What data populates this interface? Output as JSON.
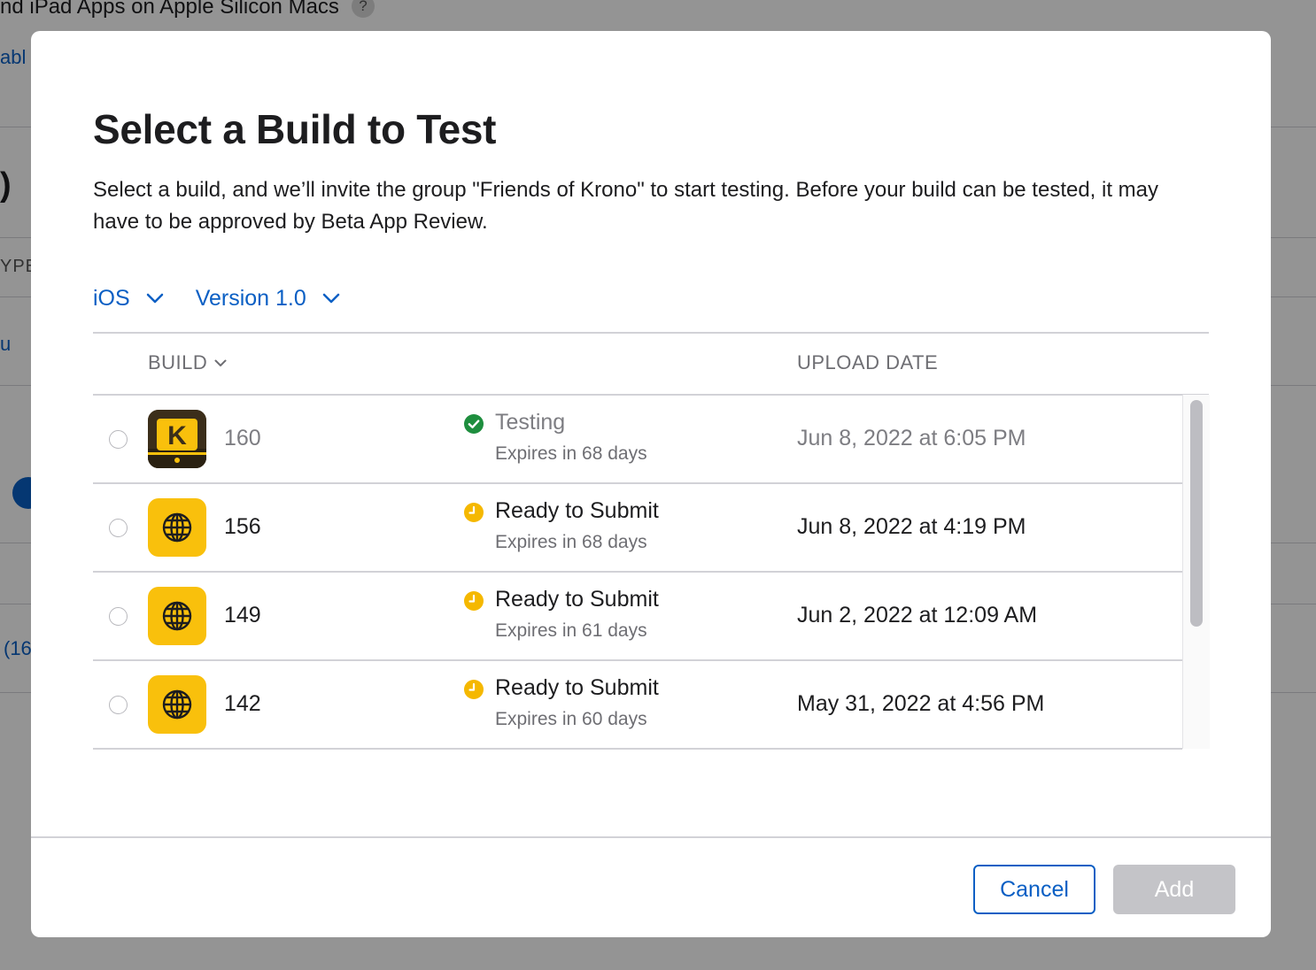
{
  "background": {
    "heading": "nd iPad Apps on Apple Silicon Macs",
    "help_glyph": "?",
    "link1": "abl",
    "paren": ")",
    "column": "YPE",
    "link2": "u",
    "link3": "(16"
  },
  "modal": {
    "title": "Select a Build to Test",
    "description": "Select a build, and we’ll invite the group \"Friends of Krono\" to start testing. Before your build can be tested, it may have to be approved by Beta App Review.",
    "filters": {
      "platform": "iOS",
      "version": "Version 1.0"
    },
    "columns": {
      "build": "BUILD",
      "upload_date": "UPLOAD DATE"
    },
    "builds": [
      {
        "number": "160",
        "status": "Testing",
        "expires": "Expires in 68 days",
        "upload_date": "Jun 8, 2022 at 6:05 PM",
        "icon": "krono-app-icon",
        "status_icon": "check-circle-icon",
        "status_color": "#1e8e3e"
      },
      {
        "number": "156",
        "status": "Ready to Submit",
        "expires": "Expires in 68 days",
        "upload_date": "Jun 8, 2022 at 4:19 PM",
        "icon": "globe-app-icon",
        "status_icon": "clock-icon",
        "status_color": "#f5b800"
      },
      {
        "number": "149",
        "status": "Ready to Submit",
        "expires": "Expires in 61 days",
        "upload_date": "Jun 2, 2022 at 12:09 AM",
        "icon": "globe-app-icon",
        "status_icon": "clock-icon",
        "status_color": "#f5b800"
      },
      {
        "number": "142",
        "status": "Ready to Submit",
        "expires": "Expires in 60 days",
        "upload_date": "May 31, 2022 at 4:56 PM",
        "icon": "globe-app-icon",
        "status_icon": "clock-icon",
        "status_color": "#f5b800"
      }
    ],
    "buttons": {
      "cancel": "Cancel",
      "add": "Add"
    },
    "colors": {
      "accent": "#0a5fc4",
      "disabled_button": "#c4c4c8",
      "app_icon_yellow": "#f9c00c"
    }
  }
}
